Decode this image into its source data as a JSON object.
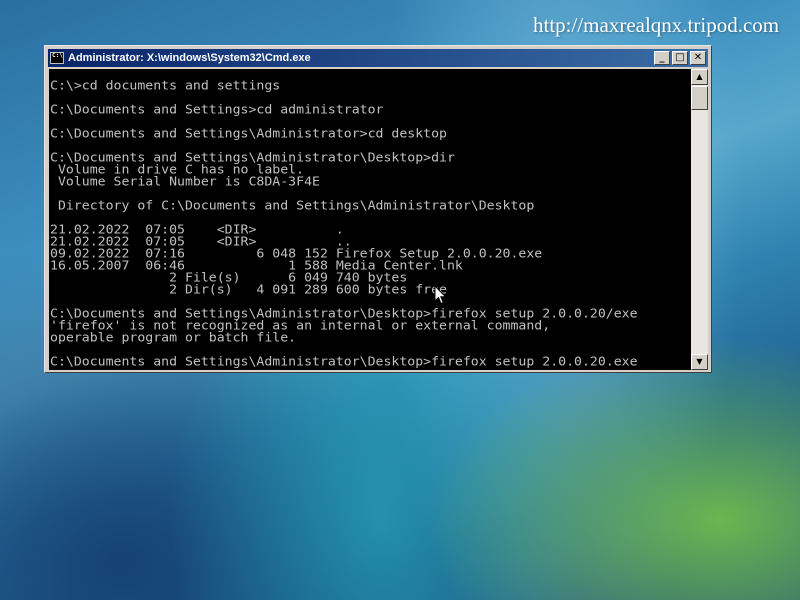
{
  "watermark": "http://maxrealqnx.tripod.com",
  "window": {
    "title": "Administrator: X:\\windows\\System32\\Cmd.exe",
    "minimize_glyph": "_",
    "maximize_glyph": "□",
    "close_glyph": "✕"
  },
  "console": {
    "lines": [
      "C:\\>cd documents and settings",
      "",
      "C:\\Documents and Settings>cd administrator",
      "",
      "C:\\Documents and Settings\\Administrator>cd desktop",
      "",
      "C:\\Documents and Settings\\Administrator\\Desktop>dir",
      " Volume in drive C has no label.",
      " Volume Serial Number is C8DA-3F4E",
      "",
      " Directory of C:\\Documents and Settings\\Administrator\\Desktop",
      "",
      "21.02.2022  07:05    <DIR>          .",
      "21.02.2022  07:05    <DIR>          ..",
      "09.02.2022  07:16         6 048 152 Firefox Setup 2.0.0.20.exe",
      "16.05.2007  06:46             1 588 Media Center.lnk",
      "               2 File(s)      6 049 740 bytes",
      "               2 Dir(s)   4 091 289 600 bytes free",
      "",
      "C:\\Documents and Settings\\Administrator\\Desktop>firefox setup 2.0.0.20/exe",
      "'firefox' is not recognized as an internal or external command,",
      "operable program or batch file.",
      "",
      "C:\\Documents and Settings\\Administrator\\Desktop>firefox setup 2.0.0.20.exe"
    ]
  },
  "scrollbar": {
    "up_glyph": "▲",
    "down_glyph": "▼"
  },
  "icons": {
    "app": "cmd-app-icon",
    "cursor": "mouse-pointer-icon"
  }
}
